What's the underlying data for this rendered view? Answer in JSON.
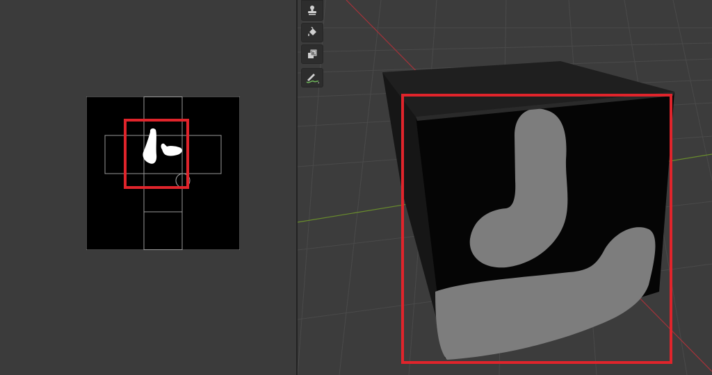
{
  "image_editor": {
    "canvas": "uv-texture-canvas",
    "highlight_color": "#e0242b"
  },
  "viewport": {
    "highlight_color": "#e0242b",
    "axis_x_color": "#a8323a",
    "axis_y_color": "#6a8e2c"
  },
  "toolshelf": {
    "tools": [
      {
        "icon": "stamp-icon"
      },
      {
        "icon": "fill-bucket-icon"
      },
      {
        "icon": "mask-icon"
      },
      {
        "icon": "draw-brush-icon"
      }
    ]
  }
}
